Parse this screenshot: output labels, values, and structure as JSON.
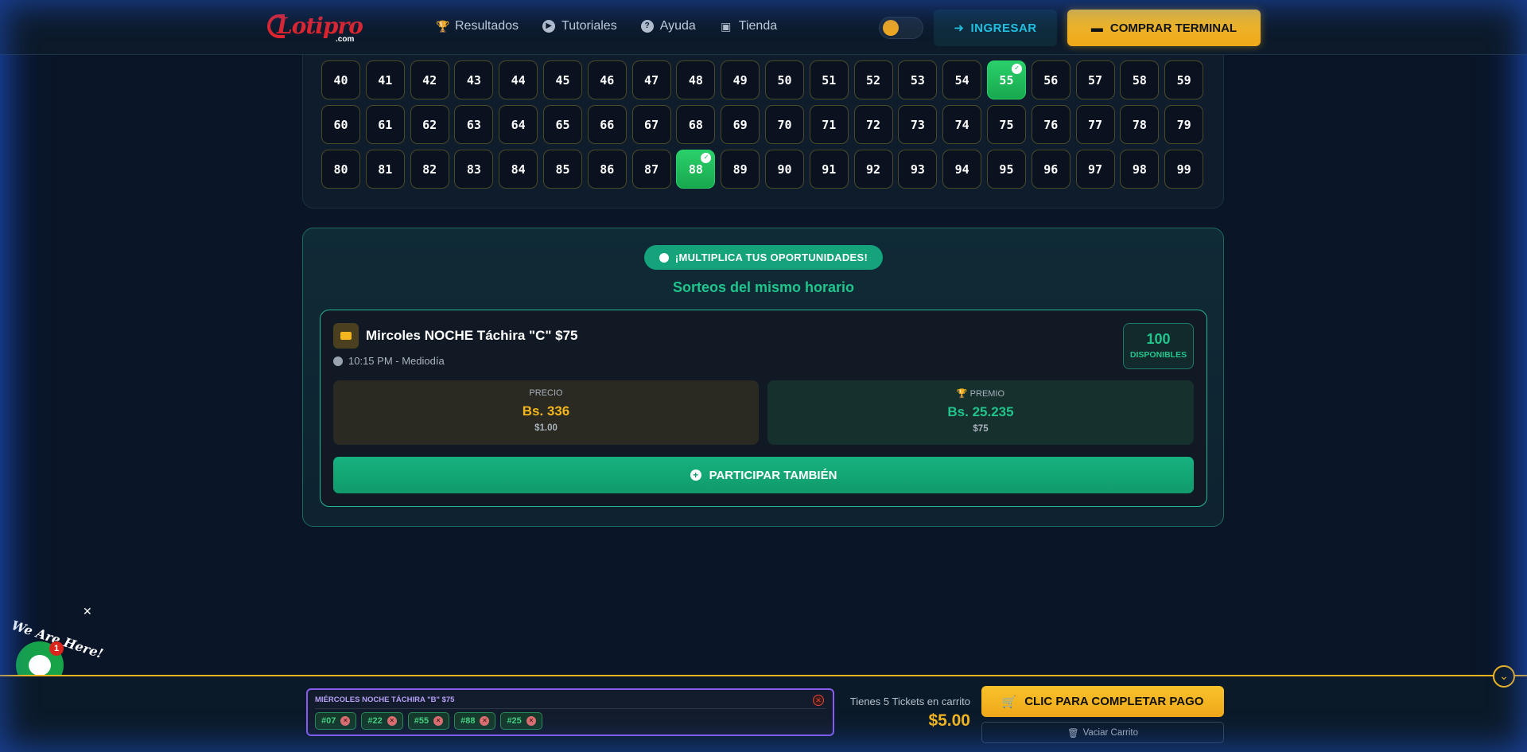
{
  "header": {
    "logo_text": "Lotipro",
    "logo_suffix": ".com",
    "nav": [
      {
        "label": "Resultados",
        "icon": "trophy-icon"
      },
      {
        "label": "Tutoriales",
        "icon": "play-icon"
      },
      {
        "label": "Ayuda",
        "icon": "help-icon"
      },
      {
        "label": "Tienda",
        "icon": "store-icon"
      }
    ],
    "theme_toggle": "moon-icon",
    "login_label": "INGRESAR",
    "buy_label": "COMPRAR TERMINAL"
  },
  "numbers": {
    "rows": [
      [
        "40",
        "41",
        "42",
        "43",
        "44",
        "45",
        "46",
        "47",
        "48",
        "49",
        "50",
        "51",
        "52",
        "53",
        "54",
        "55",
        "56",
        "57",
        "58",
        "59"
      ],
      [
        "60",
        "61",
        "62",
        "63",
        "64",
        "65",
        "66",
        "67",
        "68",
        "69",
        "70",
        "71",
        "72",
        "73",
        "74",
        "75",
        "76",
        "77",
        "78",
        "79"
      ],
      [
        "80",
        "81",
        "82",
        "83",
        "84",
        "85",
        "86",
        "87",
        "88",
        "89",
        "90",
        "91",
        "92",
        "93",
        "94",
        "95",
        "96",
        "97",
        "98",
        "99"
      ]
    ],
    "selected": [
      "55",
      "88"
    ]
  },
  "multiply": {
    "pill_label": "¡MULTIPLICA TUS OPORTUNIDADES!",
    "subtitle": "Sorteos del mismo horario",
    "draw": {
      "title": "Mircoles NOCHE Táchira \"C\" $75",
      "time": "10:15 PM - Mediodía",
      "available_count": "100",
      "available_label": "DISPONIBLES",
      "price_label": "PRECIO",
      "price_value": "Bs. 336",
      "price_usd": "$1.00",
      "prize_label": "PREMIO",
      "prize_value": "Bs. 25.235",
      "prize_usd": "$75",
      "participate_label": "PARTICIPAR TAMBIÉN"
    }
  },
  "chat": {
    "greeting": "We Are Here!",
    "badge": "1"
  },
  "cart": {
    "draw_title": "MIÉRCOLES NOCHE TÁCHIRA \"B\" $75",
    "tickets": [
      "#07",
      "#22",
      "#55",
      "#88",
      "#25"
    ],
    "count_text": "Tienes 5 Tickets en carrito",
    "total": "$5.00",
    "pay_label": "CLIC PARA COMPLETAR PAGO",
    "empty_label": "Vaciar Carrito"
  },
  "colors": {
    "accent_gold": "#f3b61e",
    "accent_green": "#21c58c",
    "selected_green": "#2ad06a"
  }
}
